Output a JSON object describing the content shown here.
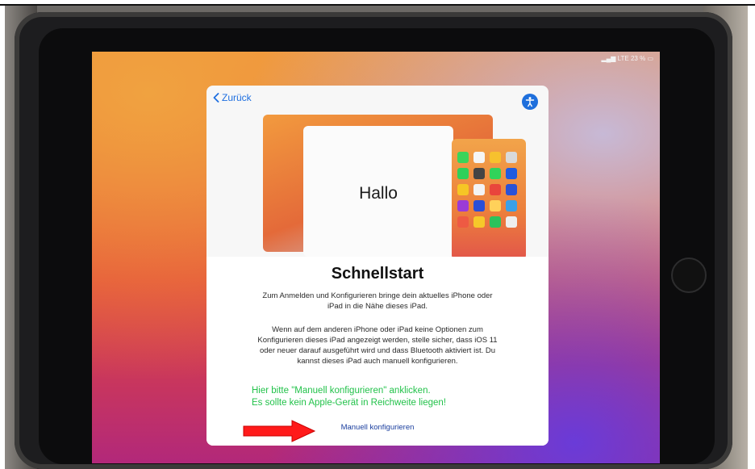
{
  "screen": {
    "status": "LTE 23 %",
    "back_label": "Zurück",
    "accessibility": "accessibility-icon",
    "illustration": {
      "hello": "Hallo",
      "app_colors": [
        "#3bd45a",
        "#f5f5f5",
        "#f7c12e",
        "#d9d9d9",
        "#2ed05a",
        "#444444",
        "#31d35a",
        "#1f5be0",
        "#f6c625",
        "#f3f3f3",
        "#e9453c",
        "#2a52d6",
        "#9b3bd6",
        "#2b4ed7",
        "#ffd15a",
        "#3aa0e8",
        "#ee5a43",
        "#f6c82a",
        "#2bc25c",
        "#eeeeee"
      ]
    },
    "title": "Schnellstart",
    "paragraph1": "Zum Anmelden und Konfigurieren bringe dein aktuelles iPhone oder iPad in die Nähe dieses iPad.",
    "paragraph2": "Wenn auf dem anderen iPhone oder iPad keine Optionen zum Konfigurieren dieses iPad angezeigt werden, stelle sicher, dass iOS 11 oder neuer darauf ausgeführt wird und dass Bluetooth aktiviert ist. Du kannst dieses iPad auch manuell konfigurieren.",
    "annotation_line1": "Hier bitte \"Manuell konfigurieren\" anklicken.",
    "annotation_line2": "Es sollte kein Apple-Gerät in Reichweite liegen!",
    "manual_link": "Manuell konfigurieren"
  },
  "colors": {
    "accent": "#1f6fe0",
    "annotation": "#22c24a",
    "arrow": "#ff1a1a"
  }
}
